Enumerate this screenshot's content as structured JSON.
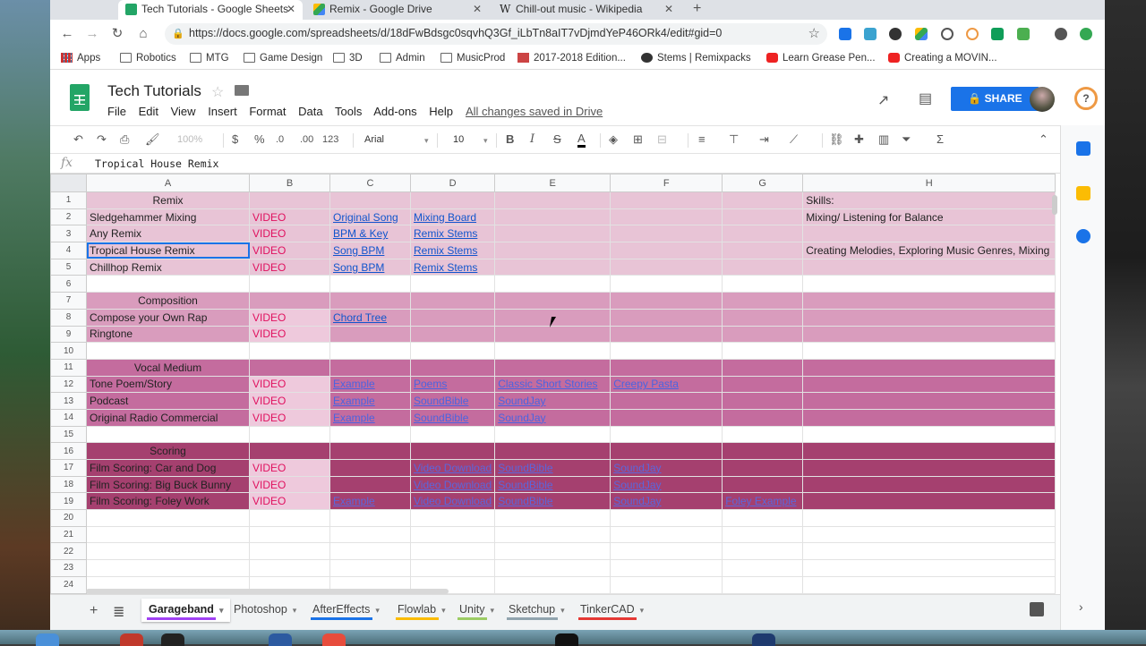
{
  "browser": {
    "tabs": [
      {
        "title": "Tech Tutorials - Google Sheets",
        "active": true
      },
      {
        "title": "Remix - Google Drive",
        "active": false
      },
      {
        "title": "Chill-out music - Wikipedia",
        "active": false
      }
    ],
    "url": "https://docs.google.com/spreadsheets/d/18dFwBdsgc0sqvhQ3Gf_iLbTn8aIT7vDjmdYeP46ORk4/edit#gid=0",
    "bookmarks": [
      "Apps",
      "Robotics",
      "MTG",
      "Game Design",
      "3D",
      "Admin",
      "MusicProd",
      "2017-2018 Edition...",
      "Stems | Remixpacks",
      "Learn Grease Pen...",
      "Creating a MOVIN..."
    ]
  },
  "doc": {
    "title": "Tech Tutorials",
    "menu": [
      "File",
      "Edit",
      "View",
      "Insert",
      "Format",
      "Data",
      "Tools",
      "Add-ons",
      "Help"
    ],
    "save_status": "All changes saved in Drive",
    "share_label": "SHARE"
  },
  "toolbar": {
    "zoom": "100%",
    "currency": "$",
    "percent": "%",
    "dec_less": ".0",
    "dec_more": ".00",
    "more_formats": "123",
    "font": "Arial",
    "font_size": "10"
  },
  "formula": {
    "fx": "fx",
    "value": "Tropical House Remix"
  },
  "columns": [
    "A",
    "B",
    "C",
    "D",
    "E",
    "F",
    "G",
    "H"
  ],
  "rows": [
    {
      "n": "1",
      "section": "remix",
      "cells": [
        "Remix",
        "",
        "",
        "",
        "",
        "",
        "",
        "Skills:"
      ]
    },
    {
      "n": "2",
      "section": "remix",
      "cells": [
        "Sledgehammer Mixing",
        "VIDEO",
        "Original Song",
        "Mixing Board",
        "",
        "",
        "",
        "Mixing/ Listening for Balance"
      ]
    },
    {
      "n": "3",
      "section": "remix",
      "cells": [
        "Any Remix",
        "VIDEO",
        "BPM & Key",
        "Remix Stems",
        "",
        "",
        "",
        ""
      ]
    },
    {
      "n": "4",
      "section": "remix",
      "cells": [
        "Tropical House Remix",
        "VIDEO",
        "Song BPM",
        "Remix Stems",
        "",
        "",
        "",
        "Creating Melodies, Exploring Music Genres, Mixing"
      ]
    },
    {
      "n": "5",
      "section": "remix",
      "cells": [
        "Chillhop Remix",
        "VIDEO",
        "Song BPM",
        "Remix Stems",
        "",
        "",
        "",
        ""
      ]
    },
    {
      "n": "6",
      "section": "blank",
      "cells": [
        "",
        "",
        "",
        "",
        "",
        "",
        "",
        ""
      ]
    },
    {
      "n": "7",
      "section": "comp",
      "cells": [
        "Composition",
        "",
        "",
        "",
        "",
        "",
        "",
        ""
      ]
    },
    {
      "n": "8",
      "section": "comp",
      "cells": [
        "Compose your Own Rap",
        "VIDEO",
        "Chord Tree",
        "",
        "",
        "",
        "",
        ""
      ]
    },
    {
      "n": "9",
      "section": "comp",
      "cells": [
        "Ringtone",
        "VIDEO",
        "",
        "",
        "",
        "",
        "",
        ""
      ]
    },
    {
      "n": "10",
      "section": "blank",
      "cells": [
        "",
        "",
        "",
        "",
        "",
        "",
        "",
        ""
      ]
    },
    {
      "n": "11",
      "section": "vocal",
      "cells": [
        "Vocal Medium",
        "",
        "",
        "",
        "",
        "",
        "",
        ""
      ]
    },
    {
      "n": "12",
      "section": "vocal",
      "cells": [
        "Tone Poem/Story",
        "VIDEO",
        "Example",
        "Poems",
        "Classic Short Stories",
        "Creepy Pasta",
        "",
        ""
      ]
    },
    {
      "n": "13",
      "section": "vocal",
      "cells": [
        "Podcast",
        "VIDEO",
        "Example",
        "SoundBible",
        "SoundJay",
        "",
        "",
        ""
      ]
    },
    {
      "n": "14",
      "section": "vocal",
      "cells": [
        "Original Radio Commercial",
        "VIDEO",
        "Example",
        "SoundBible",
        "SoundJay",
        "",
        "",
        ""
      ]
    },
    {
      "n": "15",
      "section": "blank",
      "cells": [
        "",
        "",
        "",
        "",
        "",
        "",
        "",
        ""
      ]
    },
    {
      "n": "16",
      "section": "score",
      "cells": [
        "Scoring",
        "",
        "",
        "",
        "",
        "",
        "",
        ""
      ]
    },
    {
      "n": "17",
      "section": "score",
      "cells": [
        "Film Scoring: Car and Dog",
        "VIDEO",
        "",
        "Video Download",
        "SoundBible",
        "SoundJay",
        "",
        ""
      ]
    },
    {
      "n": "18",
      "section": "score",
      "cells": [
        "Film Scoring: Big Buck Bunny",
        "VIDEO",
        "",
        "Video Download",
        "SoundBible",
        "SoundJay",
        "",
        ""
      ]
    },
    {
      "n": "19",
      "section": "score",
      "cells": [
        "Film Scoring: Foley Work",
        "VIDEO",
        "Example",
        "Video Download",
        "SoundBible",
        "SoundJay",
        "Foley Example",
        ""
      ]
    },
    {
      "n": "20",
      "section": "blank",
      "cells": [
        "",
        "",
        "",
        "",
        "",
        "",
        "",
        ""
      ]
    },
    {
      "n": "21",
      "section": "blank",
      "cells": [
        "",
        "",
        "",
        "",
        "",
        "",
        "",
        ""
      ]
    },
    {
      "n": "22",
      "section": "blank",
      "cells": [
        "",
        "",
        "",
        "",
        "",
        "",
        "",
        ""
      ]
    },
    {
      "n": "23",
      "section": "blank",
      "cells": [
        "",
        "",
        "",
        "",
        "",
        "",
        "",
        ""
      ]
    },
    {
      "n": "24",
      "section": "blank",
      "cells": [
        "",
        "",
        "",
        "",
        "",
        "",
        "",
        ""
      ]
    }
  ],
  "selected_cell": "A4",
  "sheet_tabs": [
    {
      "name": "Garageband",
      "color": "#a142f4",
      "active": true
    },
    {
      "name": "Photoshop",
      "color": "",
      "active": false
    },
    {
      "name": "AfterEffects",
      "color": "#1a73e8",
      "active": false
    },
    {
      "name": "Flowlab",
      "color": "#fbbc04",
      "active": false
    },
    {
      "name": "Unity",
      "color": "#9ccc65",
      "active": false
    },
    {
      "name": "Sketchup",
      "color": "#90a4ae",
      "active": false
    },
    {
      "name": "TinkerCAD",
      "color": "#e53935",
      "active": false
    }
  ]
}
